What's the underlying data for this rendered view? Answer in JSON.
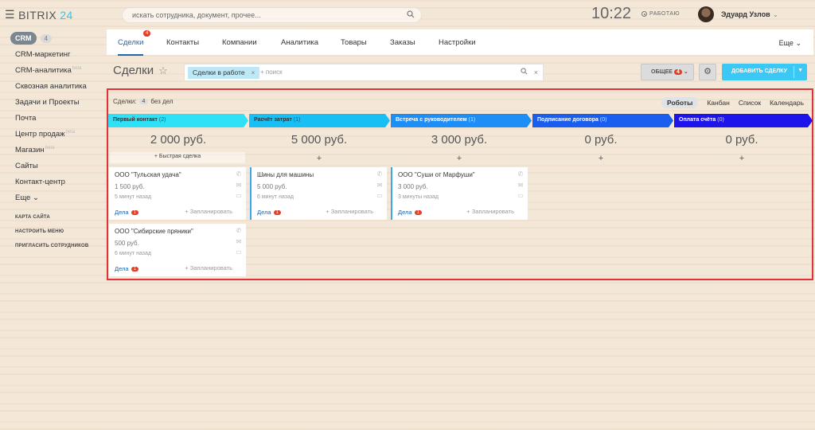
{
  "app": {
    "logo_text": "BITRIX",
    "logo_num": "24"
  },
  "search": {
    "placeholder": "искать сотрудника, документ, прочее..."
  },
  "header": {
    "time": "10:22",
    "status": "РАБОТАЮ",
    "user": "Эдуард Узлов"
  },
  "sidebar": {
    "crm_label": "CRM",
    "crm_count": "4",
    "items": [
      {
        "label": "CRM-маркетинг",
        "sup": ""
      },
      {
        "label": "CRM-аналитика",
        "sup": "beta"
      },
      {
        "label": "Сквозная аналитика",
        "sup": ""
      },
      {
        "label": "Задачи и Проекты",
        "sup": ""
      },
      {
        "label": "Почта",
        "sup": ""
      },
      {
        "label": "Центр продаж",
        "sup": "beta"
      },
      {
        "label": "Магазин",
        "sup": "beta"
      },
      {
        "label": "Сайты",
        "sup": ""
      },
      {
        "label": "Контакт-центр",
        "sup": ""
      },
      {
        "label": "Еще",
        "sup": ""
      }
    ],
    "small": [
      "КАРТА САЙТА",
      "НАСТРОИТЬ МЕНЮ",
      "ПРИГЛАСИТЬ СОТРУДНИКОВ"
    ]
  },
  "tabs": {
    "items": [
      "Сделки",
      "Контакты",
      "Компании",
      "Аналитика",
      "Товары",
      "Заказы",
      "Настройки"
    ],
    "deals_badge": "4",
    "more": "Еще"
  },
  "toolbar": {
    "title": "Сделки",
    "filter_chip": "Сделки в работе",
    "filter_placeholder": "+ поиск",
    "general": "ОБЩЕЕ",
    "general_badge": "4",
    "add": "ДОБАВИТЬ СДЕЛКУ"
  },
  "board": {
    "deals_label": "Сделки:",
    "deals_count": "4",
    "no_deals": "без дел",
    "views": [
      "Роботы",
      "Канбан",
      "Список",
      "Календарь"
    ],
    "stages": [
      {
        "name": "Первый контакт",
        "count": "(2)",
        "sum": "2 000 руб.",
        "color": "#2fe1f6"
      },
      {
        "name": "Расчёт затрат",
        "count": "(1)",
        "sum": "5 000 руб.",
        "color": "#17bff5"
      },
      {
        "name": "Встреча с руководителем",
        "count": "(1)",
        "sum": "3 000 руб.",
        "color": "#1c8ef5"
      },
      {
        "name": "Подписание договора",
        "count": "(0)",
        "sum": "0 руб.",
        "color": "#1a5ef0"
      },
      {
        "name": "Оплата счёта",
        "count": "(0)",
        "sum": "0 руб.",
        "color": "#1d14ec"
      }
    ],
    "quick": "+ Быстрая сделка",
    "plus": "+",
    "cards": [
      {
        "title": "ООО \"Тульская удача\"",
        "price": "1 500 руб.",
        "ago": "5 минут назад",
        "deals": "Дела",
        "badge": "1",
        "plan": "+ Запланировать"
      },
      {
        "title": "Шины для машины",
        "price": "5 000 руб.",
        "ago": "6 минут назад",
        "deals": "Дела",
        "badge": "1",
        "plan": "+ Запланировать"
      },
      {
        "title": "ООО \"Суши от Марфуши\"",
        "price": "3 000 руб.",
        "ago": "3 минуты назад",
        "deals": "Дела",
        "badge": "1",
        "plan": "+ Запланировать"
      },
      {
        "title": "ООО \"Сибирские пряники\"",
        "price": "500 руб.",
        "ago": "6 минут назад",
        "deals": "Дела",
        "badge": "1",
        "plan": "+ Запланировать"
      }
    ]
  }
}
